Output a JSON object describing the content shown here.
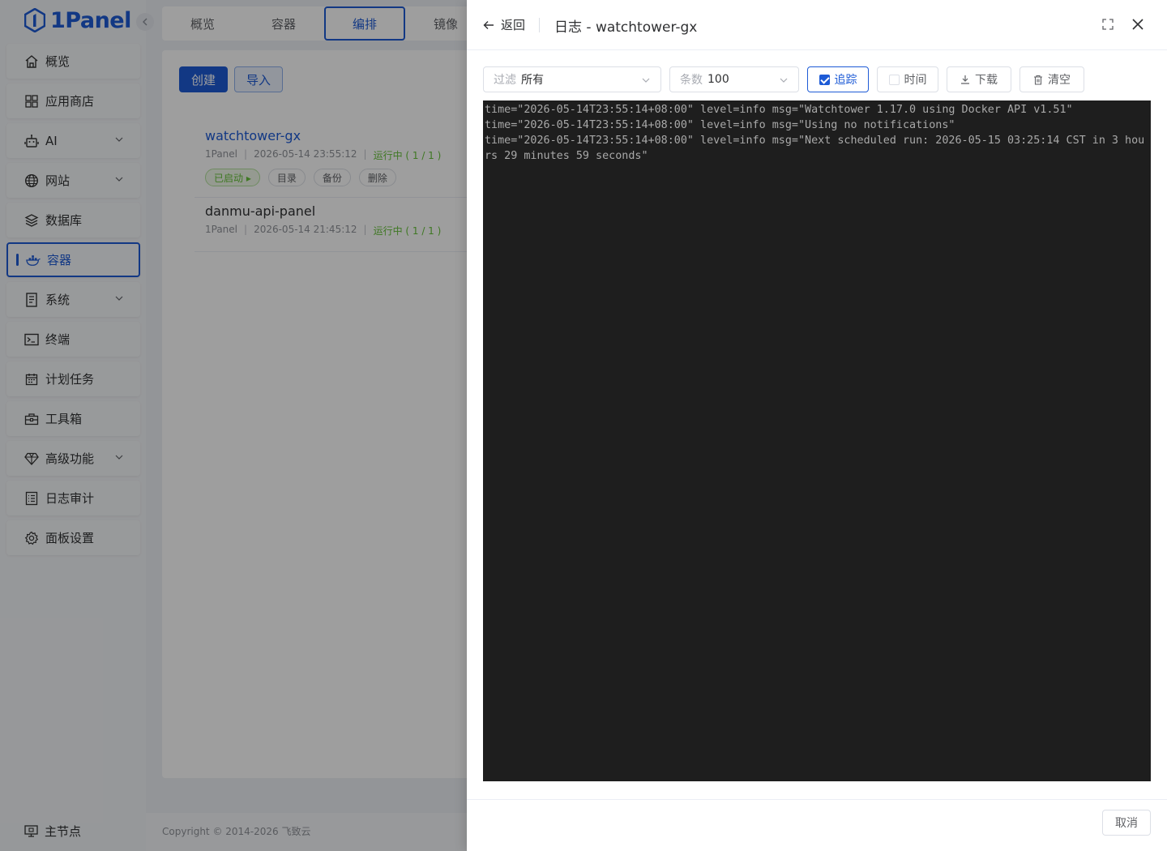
{
  "app": {
    "logo_text": "1Panel"
  },
  "sidebar": {
    "items": [
      {
        "label": "概览",
        "icon": "home-icon",
        "has_sub": false
      },
      {
        "label": "应用商店",
        "icon": "grid-icon",
        "has_sub": false
      },
      {
        "label": "AI",
        "icon": "robot-icon",
        "has_sub": true
      },
      {
        "label": "网站",
        "icon": "globe-icon",
        "has_sub": true
      },
      {
        "label": "数据库",
        "icon": "layers-icon",
        "has_sub": false
      },
      {
        "label": "容器",
        "icon": "docker-icon",
        "has_sub": false,
        "active": true
      },
      {
        "label": "系统",
        "icon": "document-icon",
        "has_sub": true
      },
      {
        "label": "终端",
        "icon": "terminal-icon",
        "has_sub": false
      },
      {
        "label": "计划任务",
        "icon": "calendar-icon",
        "has_sub": false
      },
      {
        "label": "工具箱",
        "icon": "toolbox-icon",
        "has_sub": false
      },
      {
        "label": "高级功能",
        "icon": "diamond-icon",
        "has_sub": true
      },
      {
        "label": "日志审计",
        "icon": "log-icon",
        "has_sub": false
      },
      {
        "label": "面板设置",
        "icon": "gear-icon",
        "has_sub": false
      }
    ],
    "node_label": "主节点"
  },
  "main": {
    "tabs": [
      {
        "label": "概览"
      },
      {
        "label": "容器"
      },
      {
        "label": "编排",
        "active": true
      },
      {
        "label": "镜像"
      }
    ],
    "create_label": "创建",
    "import_label": "导入",
    "compose_list": [
      {
        "name": "watchtower-gx",
        "source": "1Panel",
        "created": "2026-05-14 23:55:12",
        "status": "运行中 ( 1 / 1 )",
        "actions": [
          "已启动 ▸",
          "目录",
          "备份",
          "删除"
        ]
      },
      {
        "name": "danmu-api-panel",
        "source": "1Panel",
        "created": "2026-05-14 21:45:12",
        "status": "运行中 ( 1 / 1 )"
      }
    ],
    "copyright": "Copyright © 2014-2026 飞致云"
  },
  "drawer": {
    "back_label": "返回",
    "title": "日志 - watchtower-gx",
    "filter": {
      "prefix": "过滤",
      "value": "所有"
    },
    "count": {
      "prefix": "条数",
      "value": "100"
    },
    "follow_label": "追踪",
    "follow_checked": true,
    "time_label": "时间",
    "time_checked": false,
    "download_label": "下载",
    "clear_label": "清空",
    "log_lines": [
      "time=\"2026-05-14T23:55:14+08:00\" level=info msg=\"Watchtower 1.17.0 using Docker API v1.51\"",
      "time=\"2026-05-14T23:55:14+08:00\" level=info msg=\"Using no notifications\"",
      "time=\"2026-05-14T23:55:14+08:00\" level=info msg=\"Next scheduled run: 2026-05-15 03:25:14 CST in 3 hours 29 minutes 59 seconds\""
    ],
    "cancel_label": "取消"
  },
  "colors": {
    "accent": "#1e5bd6",
    "success": "#67c23a",
    "log_bg": "#1e1e1e"
  }
}
